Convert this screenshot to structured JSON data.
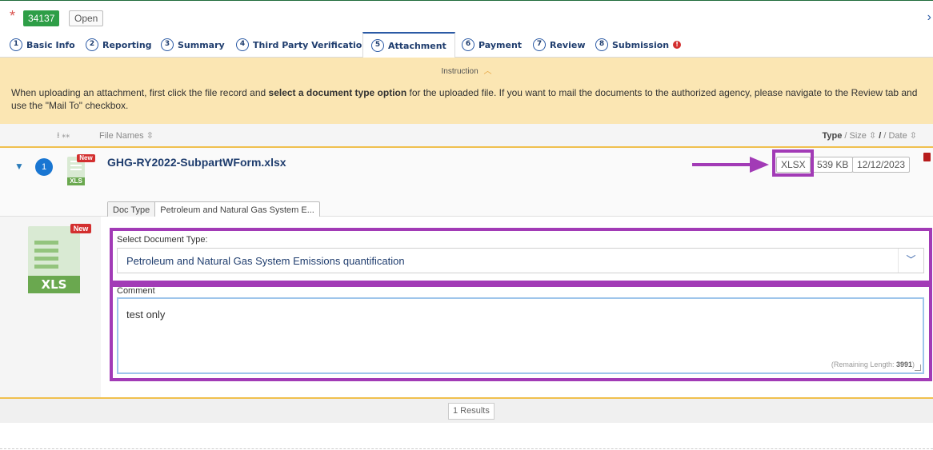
{
  "header": {
    "required_mark": "*",
    "record_id": "34137",
    "status": "Open",
    "expand_glyph": "›"
  },
  "tabs": [
    {
      "num": "1",
      "label": "Basic Info"
    },
    {
      "num": "2",
      "label": "Reporting"
    },
    {
      "num": "3",
      "label": "Summary"
    },
    {
      "num": "4",
      "label": "Third Party Verification"
    },
    {
      "num": "5",
      "label": "Attachment"
    },
    {
      "num": "6",
      "label": "Payment"
    },
    {
      "num": "7",
      "label": "Review"
    },
    {
      "num": "8",
      "label": "Submission"
    }
  ],
  "active_tab": "Attachment",
  "instruction": {
    "title": "Instruction",
    "text_before": "When uploading an attachment, first click the file record and ",
    "text_bold": "select a document type option",
    "text_after": " for the uploaded file. If you want to mail the documents to the authorized agency, please navigate to the Review tab and use the \"Mail To\" checkbox."
  },
  "list_header": {
    "download_icon": "download-icon",
    "file_names": "File Names",
    "type_label": "Type",
    "size_date_label": "/ Size",
    "date_label": "/ Date"
  },
  "file": {
    "index": "1",
    "new_badge": "New",
    "icon_label": "XLS",
    "name": "GHG-RY2022-SubpartWForm.xlsx",
    "doc_type_label": "Doc Type",
    "doc_type_value": "Petroleum and Natural Gas System E...",
    "type": "XLSX",
    "size": "539 KB",
    "date": "12/12/2023"
  },
  "detail": {
    "new_badge": "New",
    "icon_label": "XLS",
    "select_label": "Select Document Type:",
    "select_value": "Petroleum and Natural Gas System Emissions quantification",
    "comment_label": "Comment",
    "comment_value": "test only",
    "remaining_label": "(Remaining Length: ",
    "remaining_value": "3991",
    "remaining_close": ")"
  },
  "footer": {
    "results": "1 Results"
  },
  "colors": {
    "highlight": "#a23bb6",
    "instruction_bg": "#fbe6b3",
    "brand_blue": "#1f3d6e",
    "status_green": "#2e9e47"
  }
}
